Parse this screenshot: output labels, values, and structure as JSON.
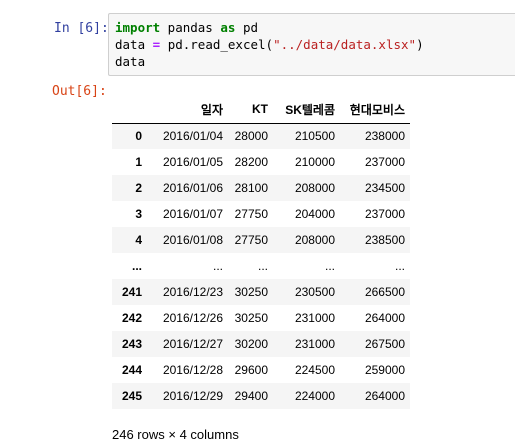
{
  "input_prompt": "In [6]:",
  "output_prompt": "Out[6]:",
  "code": {
    "line1": {
      "kw_import": "import",
      "pkg": " pandas ",
      "kw_as": "as",
      "alias": " pd"
    },
    "line2": {
      "var": "data ",
      "eq": "=",
      "call_start": " pd.read_excel(",
      "path": "\"../data/data.xlsx\"",
      "call_end": ")"
    },
    "line3": "data"
  },
  "table": {
    "columns": [
      "",
      "일자",
      "KT",
      "SK텔레콤",
      "현대모비스"
    ],
    "rows": [
      [
        "0",
        "2016/01/04",
        "28000",
        "210500",
        "238000"
      ],
      [
        "1",
        "2016/01/05",
        "28200",
        "210000",
        "237000"
      ],
      [
        "2",
        "2016/01/06",
        "28100",
        "208000",
        "234500"
      ],
      [
        "3",
        "2016/01/07",
        "27750",
        "204000",
        "237000"
      ],
      [
        "4",
        "2016/01/08",
        "27750",
        "208000",
        "238500"
      ],
      [
        "...",
        "...",
        "...",
        "...",
        "..."
      ],
      [
        "241",
        "2016/12/23",
        "30250",
        "230500",
        "266500"
      ],
      [
        "242",
        "2016/12/26",
        "30250",
        "231000",
        "264000"
      ],
      [
        "243",
        "2016/12/27",
        "30200",
        "231000",
        "267500"
      ],
      [
        "244",
        "2016/12/28",
        "29600",
        "224500",
        "259000"
      ],
      [
        "245",
        "2016/12/29",
        "29400",
        "224000",
        "264000"
      ]
    ]
  },
  "shape_text": "246 rows × 4 columns"
}
